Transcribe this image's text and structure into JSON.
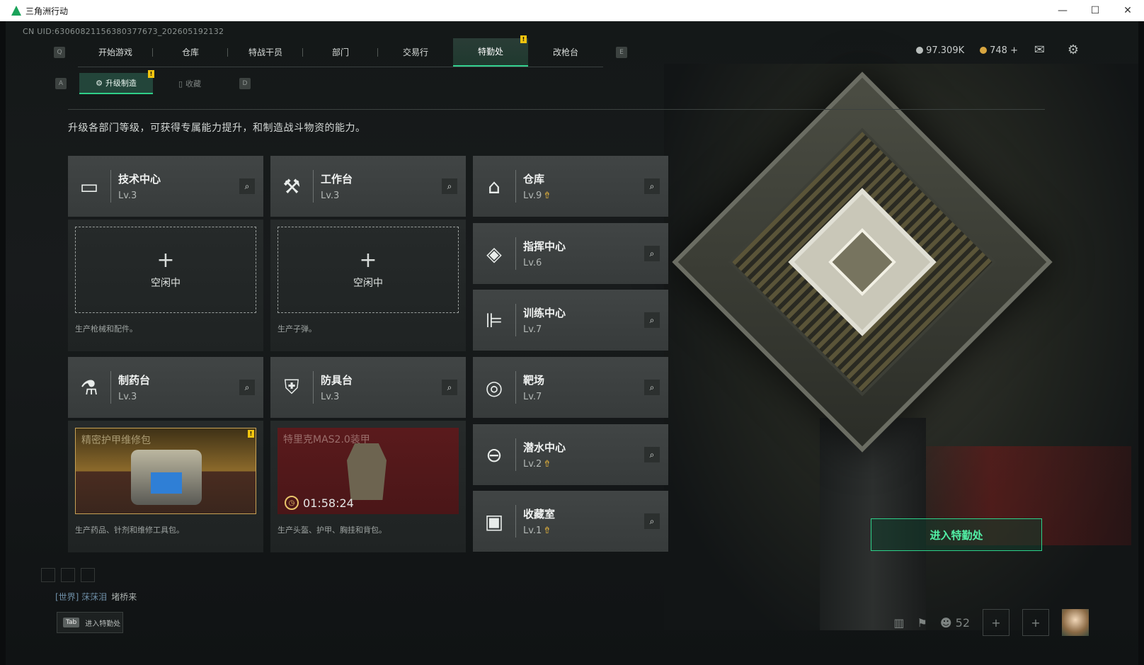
{
  "window": {
    "title": "三角洲行动",
    "min": "—",
    "max": "☐",
    "close": "✕"
  },
  "uid": "CN UID:6306082115638037767​3_202605192132",
  "nav": {
    "left_key": "Q",
    "right_key": "E",
    "tabs": [
      "开始游戏",
      "仓库",
      "特战干员",
      "部门",
      "交易行",
      "特勤处",
      "改枪台"
    ],
    "active": "特勤处"
  },
  "subnav": {
    "left_key": "A",
    "right_key": "D",
    "tabs": [
      "升级制造",
      "收藏"
    ],
    "active": "升级制造"
  },
  "currency": {
    "silver": "97.309K",
    "gold": "748",
    "gold_plus": "+"
  },
  "description": "升级各部门等级，可获得专属能力提升，和制造战斗物资的能力。",
  "departments": [
    {
      "name": "技术中心",
      "level": "Lv.3",
      "icon": "monitor-icon",
      "upgradable": false
    },
    {
      "name": "工作台",
      "level": "Lv.3",
      "icon": "tools-icon",
      "upgradable": false
    },
    {
      "name": "仓库",
      "level": "Lv.9",
      "icon": "vault-icon",
      "upgradable": true
    },
    {
      "name": "指挥中心",
      "level": "Lv.6",
      "icon": "command-icon",
      "upgradable": false
    },
    {
      "name": "训练中心",
      "level": "Lv.7",
      "icon": "dumbbell-icon",
      "upgradable": false
    },
    {
      "name": "制药台",
      "level": "Lv.3",
      "icon": "microscope-icon",
      "upgradable": false
    },
    {
      "name": "防具台",
      "level": "Lv.3",
      "icon": "armor-icon",
      "upgradable": false
    },
    {
      "name": "靶场",
      "level": "Lv.7",
      "icon": "target-icon",
      "upgradable": false
    },
    {
      "name": "潜水中心",
      "level": "Lv.2",
      "icon": "diving-icon",
      "upgradable": true
    },
    {
      "name": "收藏室",
      "level": "Lv.1",
      "icon": "collection-icon",
      "upgradable": true
    }
  ],
  "slots": {
    "tech": {
      "status": "空闲中",
      "plus": "+",
      "caption": "生产枪械和配件。"
    },
    "workbench": {
      "status": "空闲中",
      "plus": "+",
      "caption": "生产子弹。"
    },
    "pharmacy": {
      "product": "精密护甲维修包",
      "caption": "生产药品、针剂和维修工具包。"
    },
    "armor": {
      "product": "特里克MAS2.0装甲",
      "timer": "01:58:24",
      "caption": "生产头盔、护甲、胸挂和背包。"
    }
  },
  "enter_button": "进入特勤处",
  "chat": {
    "channel": "[世界] 莯莯泪",
    "message": "堵桥来"
  },
  "tab_hint": {
    "key": "Tab",
    "label": "进入特勤处"
  },
  "social": {
    "friends": "52"
  },
  "badge": "!",
  "search_glyph": "⌕",
  "upgrade_glyph": "⇮"
}
